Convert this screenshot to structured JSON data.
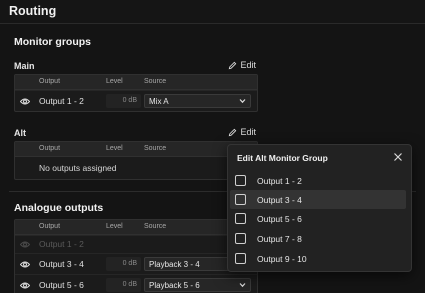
{
  "page": {
    "title": "Routing"
  },
  "monitor_groups": {
    "title": "Monitor groups",
    "edit_label": "Edit",
    "columns": {
      "output": "Output",
      "level": "Level",
      "source": "Source"
    },
    "main": {
      "label": "Main",
      "rows": [
        {
          "output": "Output 1 - 2",
          "level": "0 dB",
          "source": "Mix A"
        }
      ]
    },
    "alt": {
      "label": "Alt",
      "empty_text": "No outputs assigned"
    }
  },
  "analogue_outputs": {
    "title": "Analogue outputs",
    "columns": {
      "output": "Output",
      "level": "Level",
      "source": "Source"
    },
    "rows": [
      {
        "output": "Output 1 - 2",
        "disabled": true
      },
      {
        "output": "Output 3 - 4",
        "level": "0 dB",
        "source": "Playback 3 - 4"
      },
      {
        "output": "Output 5 - 6",
        "level": "0 dB",
        "source": "Playback 5 - 6"
      }
    ]
  },
  "modal": {
    "title": "Edit Alt Monitor Group",
    "options": [
      {
        "label": "Output 1 - 2",
        "checked": false,
        "highlighted": false
      },
      {
        "label": "Output 3 - 4",
        "checked": false,
        "highlighted": true
      },
      {
        "label": "Output 5 - 6",
        "checked": false,
        "highlighted": false
      },
      {
        "label": "Output 7 - 8",
        "checked": false,
        "highlighted": false
      },
      {
        "label": "Output 9 - 10",
        "checked": false,
        "highlighted": false
      }
    ]
  },
  "icons": {
    "edit": "pencil-icon",
    "eye": "eye-icon",
    "dropdown": "chevron-down-icon",
    "close": "close-icon"
  }
}
